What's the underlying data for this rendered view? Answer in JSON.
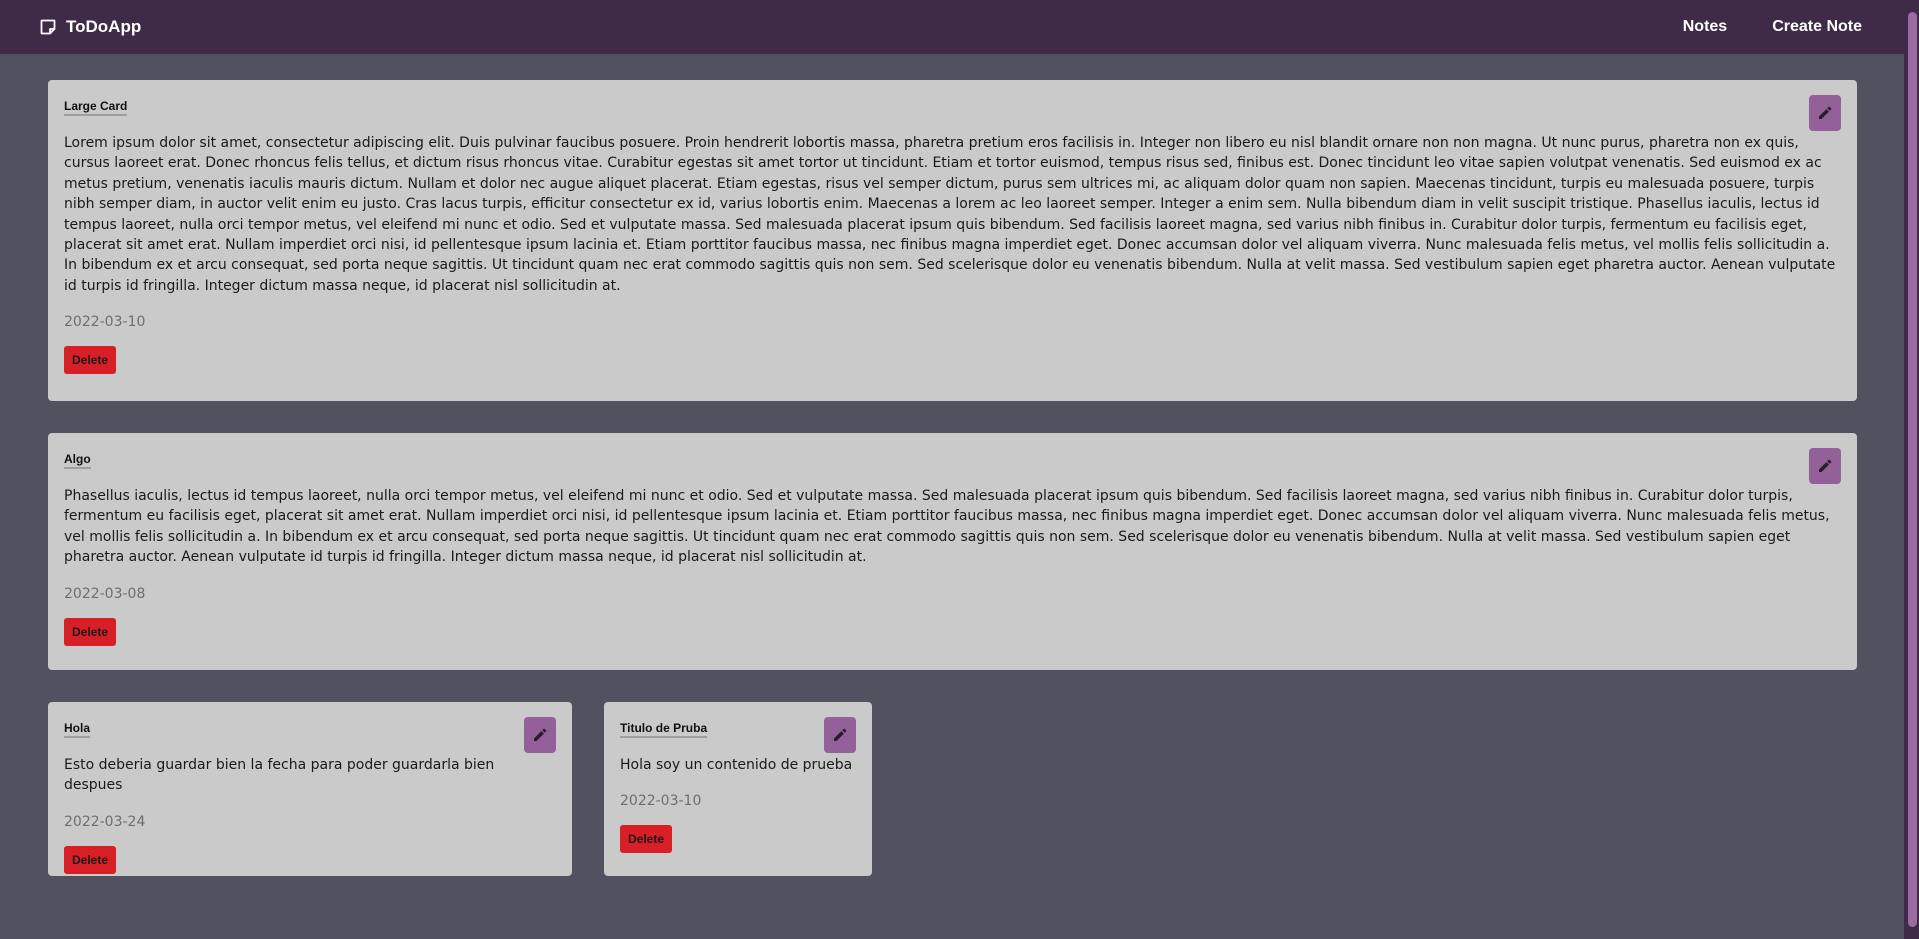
{
  "app": {
    "brand": "ToDoApp",
    "nav": {
      "notes": "Notes",
      "create_note": "Create Note"
    },
    "icons": {
      "brand": "sticky-note-icon",
      "edit": "pencil-icon"
    },
    "colors": {
      "navbar": "#3f2b47",
      "background": "#51515f",
      "card": "#cacaca",
      "edit_button": "#93609a",
      "delete_button": "#d81f26"
    }
  },
  "notes": [
    {
      "title": "Large Card",
      "content": "Lorem ipsum dolor sit amet, consectetur adipiscing elit. Duis pulvinar faucibus posuere. Proin hendrerit lobortis massa, pharetra pretium eros facilisis in. Integer non libero eu nisl blandit ornare non non magna. Ut nunc purus, pharetra non ex quis, cursus laoreet erat. Donec rhoncus felis tellus, et dictum risus rhoncus vitae. Curabitur egestas sit amet tortor ut tincidunt. Etiam et tortor euismod, tempus risus sed, finibus est. Donec tincidunt leo vitae sapien volutpat venenatis. Sed euismod ex ac metus pretium, venenatis iaculis mauris dictum. Nullam et dolor nec augue aliquet placerat. Etiam egestas, risus vel semper dictum, purus sem ultrices mi, ac aliquam dolor quam non sapien. Maecenas tincidunt, turpis eu malesuada posuere, turpis nibh semper diam, in auctor velit enim eu justo. Cras lacus turpis, efficitur consectetur ex id, varius lobortis enim. Maecenas a lorem ac leo laoreet semper. Integer a enim sem. Nulla bibendum diam in velit suscipit tristique. Phasellus iaculis, lectus id tempus laoreet, nulla orci tempor metus, vel eleifend mi nunc et odio. Sed et vulputate massa. Sed malesuada placerat ipsum quis bibendum. Sed facilisis laoreet magna, sed varius nibh finibus in. Curabitur dolor turpis, fermentum eu facilisis eget, placerat sit amet erat. Nullam imperdiet orci nisi, id pellentesque ipsum lacinia et. Etiam porttitor faucibus massa, nec finibus magna imperdiet eget. Donec accumsan dolor vel aliquam viverra. Nunc malesuada felis metus, vel mollis felis sollicitudin a. In bibendum ex et arcu consequat, sed porta neque sagittis. Ut tincidunt quam nec erat commodo sagittis quis non sem. Sed scelerisque dolor eu venenatis bibendum. Nulla at velit massa. Sed vestibulum sapien eget pharetra auctor. Aenean vulputate id turpis id fringilla. Integer dictum massa neque, id placerat nisl sollicitudin at.",
      "date": "2022-03-10",
      "delete_label": "Delete"
    },
    {
      "title": "Algo",
      "content": "Phasellus iaculis, lectus id tempus laoreet, nulla orci tempor metus, vel eleifend mi nunc et odio. Sed et vulputate massa. Sed malesuada placerat ipsum quis bibendum. Sed facilisis laoreet magna, sed varius nibh finibus in. Curabitur dolor turpis, fermentum eu facilisis eget, placerat sit amet erat. Nullam imperdiet orci nisi, id pellentesque ipsum lacinia et. Etiam porttitor faucibus massa, nec finibus magna imperdiet eget. Donec accumsan dolor vel aliquam viverra. Nunc malesuada felis metus, vel mollis felis sollicitudin a. In bibendum ex et arcu consequat, sed porta neque sagittis. Ut tincidunt quam nec erat commodo sagittis quis non sem. Sed scelerisque dolor eu venenatis bibendum. Nulla at velit massa. Sed vestibulum sapien eget pharetra auctor. Aenean vulputate id turpis id fringilla. Integer dictum massa neque, id placerat nisl sollicitudin at.",
      "date": "2022-03-08",
      "delete_label": "Delete"
    },
    {
      "title": "Hola",
      "content": "Esto deberia guardar bien la fecha para poder guardarla bien despues",
      "date": "2022-03-24",
      "delete_label": "Delete"
    },
    {
      "title": "Titulo de Pruba",
      "content": "Hola soy un contenido de prueba",
      "date": "2022-03-10",
      "delete_label": "Delete"
    }
  ]
}
